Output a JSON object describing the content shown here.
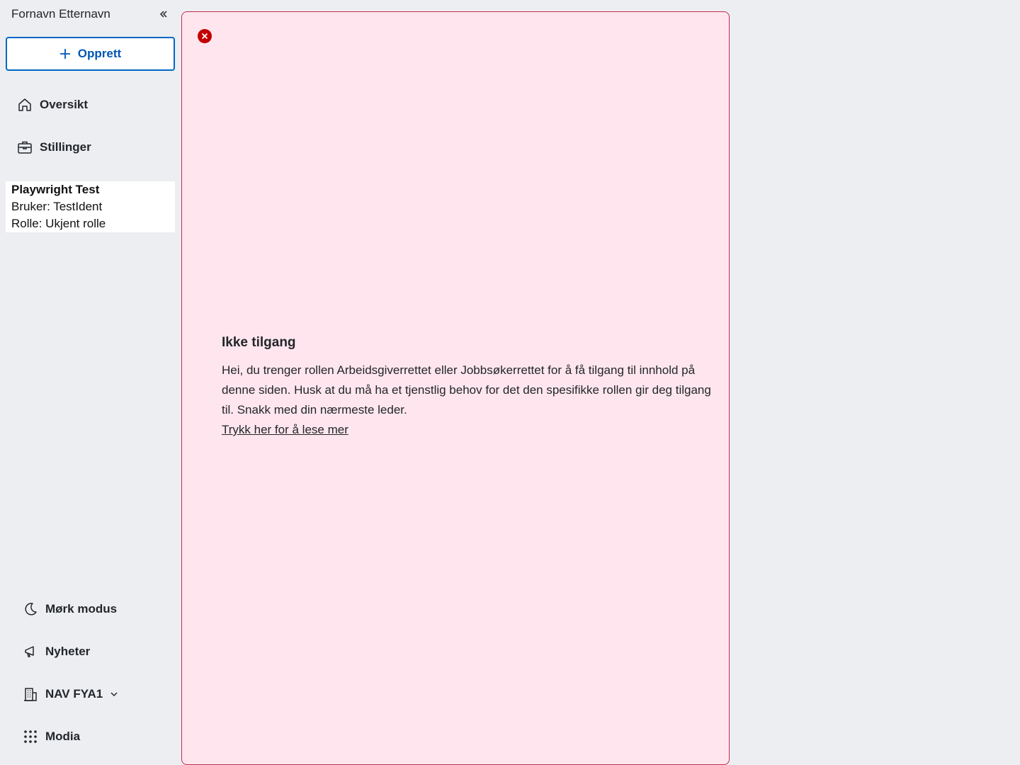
{
  "sidebar": {
    "user_name": "Fornavn Etternavn",
    "create_label": "Opprett",
    "nav": [
      {
        "label": "Oversikt",
        "icon": "home-icon"
      },
      {
        "label": "Stillinger",
        "icon": "briefcase-icon"
      }
    ],
    "info": {
      "title": "Playwright Test",
      "user": "Bruker: TestIdent",
      "role": "Rolle: Ukjent rolle"
    },
    "bottom": [
      {
        "label": "Mørk modus",
        "icon": "moon-icon"
      },
      {
        "label": "Nyheter",
        "icon": "megaphone-icon"
      },
      {
        "label": "NAV FYA1",
        "icon": "building-icon"
      },
      {
        "label": "Modia",
        "icon": "grid-icon"
      }
    ]
  },
  "main": {
    "heading": "Ikke tilgang",
    "body": "Hei, du trenger rollen Arbeidsgiverrettet eller Jobbsøkerrettet for å få tilgang til innhold på denne siden. Husk at du må ha et tjenstlig behov for det den spesifikke rollen gir deg tilgang til. Snakk med din nærmeste leder.",
    "link": "Trykk her for å lese mer"
  },
  "colors": {
    "accent": "#0067c5",
    "error": "#c30000",
    "error_bg": "#ffe6ee",
    "sidebar_bg": "#eceef1"
  }
}
